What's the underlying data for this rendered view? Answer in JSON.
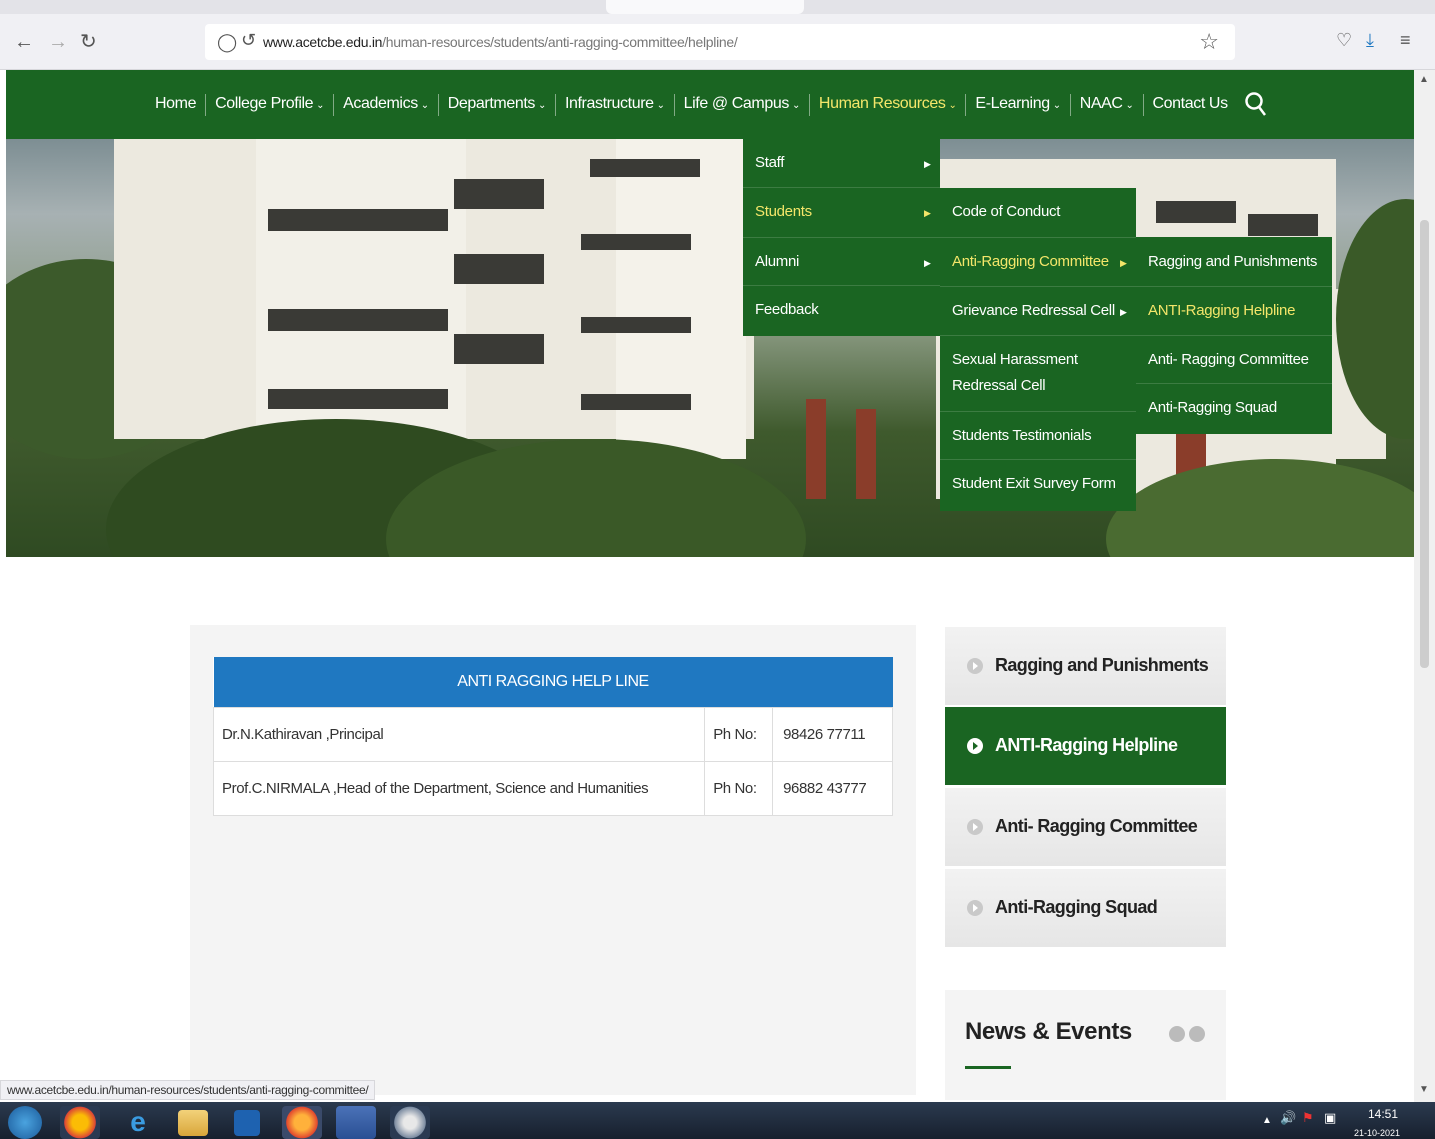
{
  "browser": {
    "url_domain": "www.acetcbe.edu.in",
    "url_path": "/human-resources/students/anti-ragging-committee/helpline/",
    "status_url": "www.acetcbe.edu.in/human-resources/students/anti-ragging-committee/"
  },
  "nav": {
    "items": [
      {
        "label": "Home",
        "caret": false,
        "active": false
      },
      {
        "label": "College Profile",
        "caret": true,
        "active": false
      },
      {
        "label": "Academics",
        "caret": true,
        "active": false
      },
      {
        "label": "Departments",
        "caret": true,
        "active": false
      },
      {
        "label": "Infrastructure",
        "caret": true,
        "active": false
      },
      {
        "label": "Life @ Campus",
        "caret": true,
        "active": false
      },
      {
        "label": "Human Resources",
        "caret": true,
        "active": true
      },
      {
        "label": "E-Learning",
        "caret": true,
        "active": false
      },
      {
        "label": "NAAC",
        "caret": true,
        "active": false
      },
      {
        "label": "Contact Us",
        "caret": false,
        "active": false
      }
    ]
  },
  "menu1": {
    "items": [
      {
        "label": "Staff",
        "active": false
      },
      {
        "label": "Students",
        "active": true
      },
      {
        "label": "Alumni",
        "active": false
      },
      {
        "label": "Feedback",
        "active": false
      }
    ]
  },
  "menu2": {
    "items": [
      {
        "label": "Code of Conduct",
        "active": false
      },
      {
        "label": "Anti-Ragging Committee",
        "active": true
      },
      {
        "label": "Grievance Redressal Cell",
        "active": false
      },
      {
        "label": "Sexual Harassment",
        "line2": "Redressal Cell",
        "active": false
      },
      {
        "label": "Students Testimonials",
        "active": false
      },
      {
        "label": "Student Exit Survey Form",
        "active": false
      }
    ]
  },
  "menu3": {
    "items": [
      {
        "label": "Ragging and Punishments",
        "active": false
      },
      {
        "label": "ANTI-Ragging Helpline",
        "active": true
      },
      {
        "label": "Anti- Ragging Committee",
        "active": false
      },
      {
        "label": "Anti-Ragging Squad",
        "active": false
      }
    ]
  },
  "helpline": {
    "title": "ANTI RAGGING HELP LINE",
    "rows": [
      {
        "name": "Dr.N.Kathiravan ,Principal",
        "ph_label": "Ph No:",
        "phone": "98426 77711"
      },
      {
        "name": "Prof.C.NIRMALA ,Head of the Department, Science and Humanities",
        "ph_label": "Ph No:",
        "phone": "96882 43777"
      }
    ]
  },
  "sidebar": {
    "items": [
      {
        "label": "Ragging and Punishments",
        "active": false
      },
      {
        "label": "ANTI-Ragging Helpline",
        "active": true
      },
      {
        "label": "Anti- Ragging Committee",
        "active": false
      },
      {
        "label": "Anti-Ragging Squad",
        "active": false
      }
    ],
    "news_title": "News & Events"
  },
  "taskbar": {
    "time": "14:51",
    "date": "21-10-2021"
  },
  "colors": {
    "nav_green": "#1a6522",
    "active_yellow": "#f4e66a",
    "table_header_blue": "#1f78c1"
  }
}
